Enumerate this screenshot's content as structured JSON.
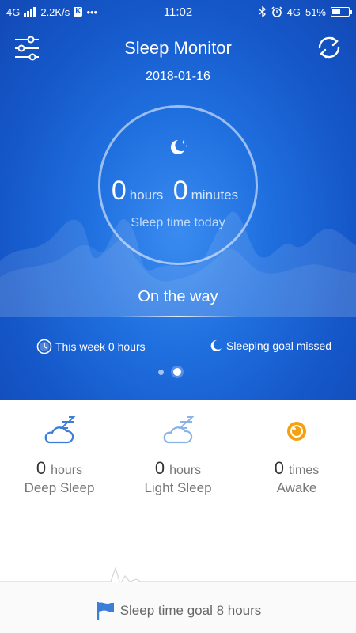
{
  "status_bar": {
    "network": "4G",
    "speed": "2.2K/s",
    "k_badge": "K",
    "more": "•••",
    "time": "11:02",
    "network_right": "4G",
    "battery": "51%",
    "battery_level": 0.51
  },
  "header": {
    "title": "Sleep Monitor",
    "date": "2018-01-16"
  },
  "summary": {
    "hours_value": "0",
    "hours_unit": "hours",
    "minutes_value": "0",
    "minutes_unit": "minutes",
    "caption": "Sleep time today",
    "status": "On the way",
    "week_text": "This week 0 hours",
    "goal_status": "Sleeping goal missed"
  },
  "pager": {
    "count": 2,
    "active": 2
  },
  "stats": [
    {
      "value": "0",
      "unit": "hours",
      "label": "Deep Sleep",
      "icon": "deep-sleep-cloud-icon"
    },
    {
      "value": "0",
      "unit": "hours",
      "label": "Light Sleep",
      "icon": "light-sleep-cloud-icon"
    },
    {
      "value": "0",
      "unit": "times",
      "label": "Awake",
      "icon": "awake-eye-icon"
    }
  ],
  "footer": {
    "goal": "Sleep time goal 8 hours"
  },
  "colors": {
    "hero_blue": "#1a63d6",
    "deep_sleep": "#3c7dd8",
    "light_sleep": "#8ab4e8",
    "awake": "#f5a00f"
  }
}
